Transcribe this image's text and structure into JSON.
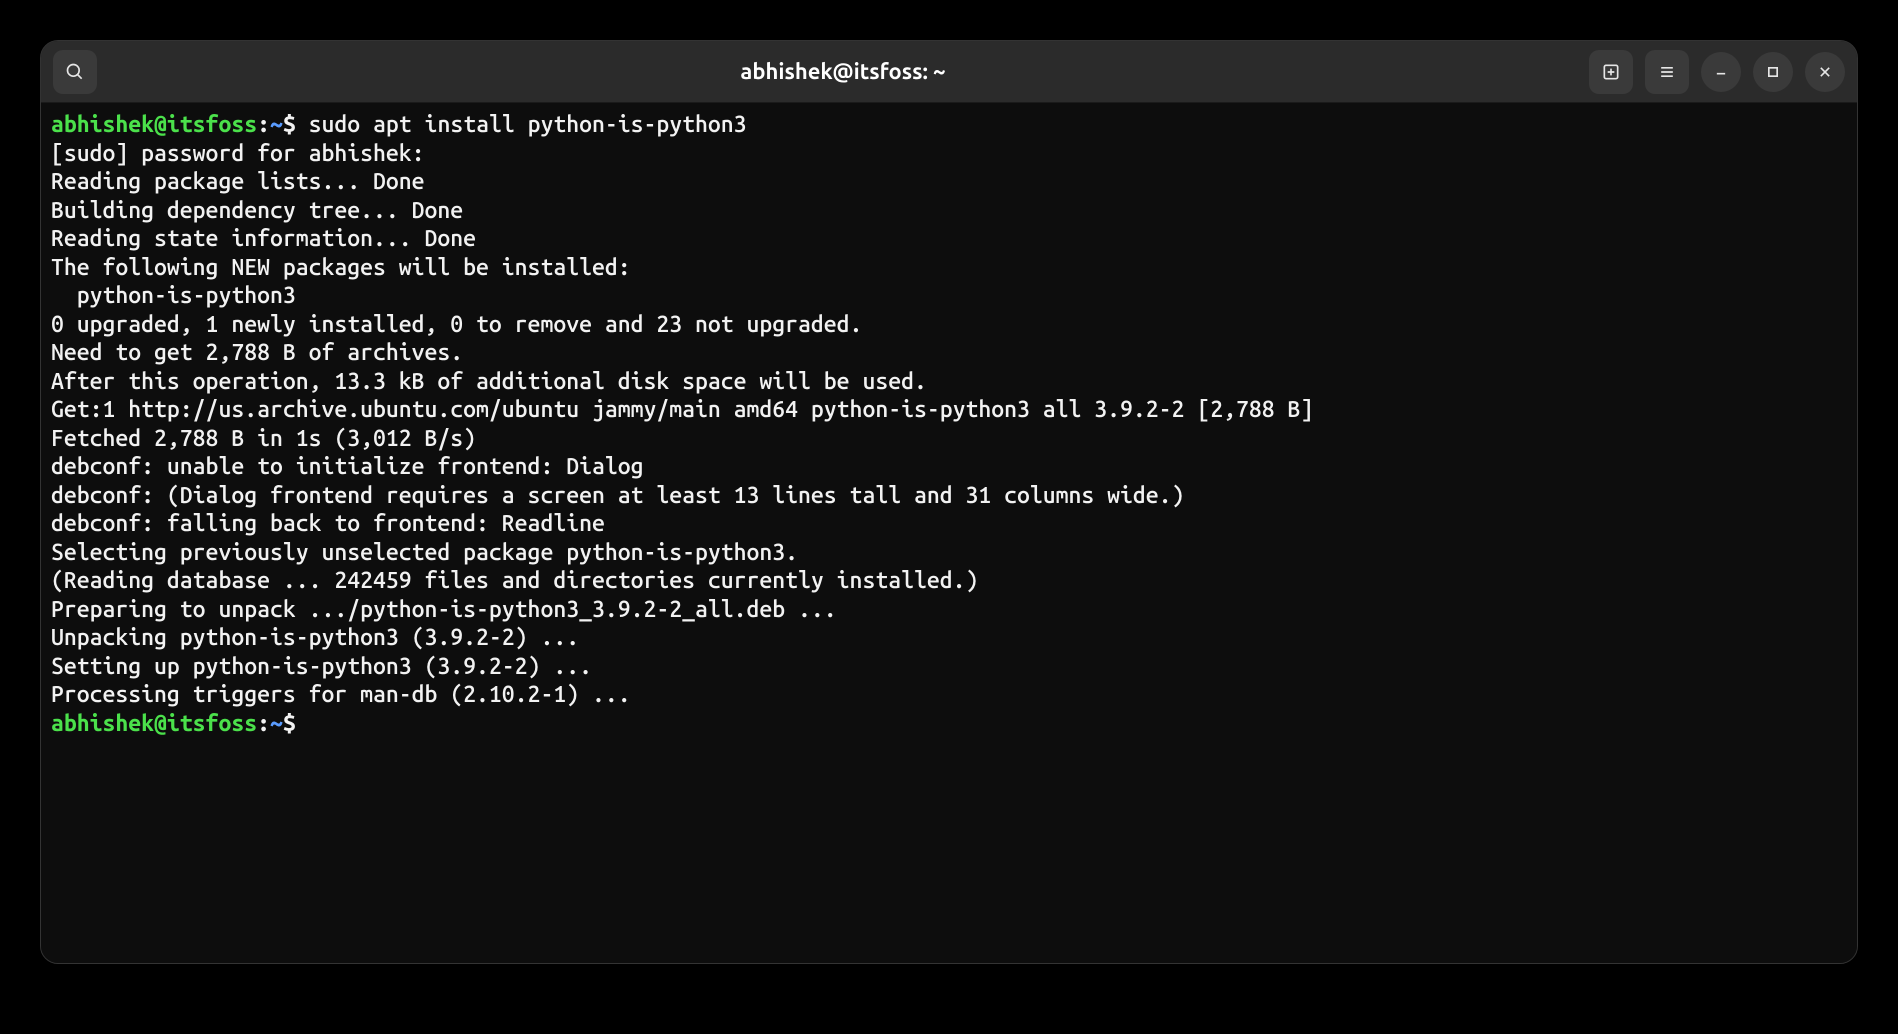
{
  "titlebar": {
    "title": "abhishek@itsfoss: ~"
  },
  "prompt": {
    "user_host": "abhishek@itsfoss",
    "sep1": ":",
    "path": "~",
    "sep2": "$ "
  },
  "command": "sudo apt install python-is-python3",
  "output_lines": [
    "[sudo] password for abhishek: ",
    "Reading package lists... Done",
    "Building dependency tree... Done",
    "Reading state information... Done",
    "The following NEW packages will be installed:",
    "  python-is-python3",
    "0 upgraded, 1 newly installed, 0 to remove and 23 not upgraded.",
    "Need to get 2,788 B of archives.",
    "After this operation, 13.3 kB of additional disk space will be used.",
    "Get:1 http://us.archive.ubuntu.com/ubuntu jammy/main amd64 python-is-python3 all 3.9.2-2 [2,788 B]",
    "Fetched 2,788 B in 1s (3,012 B/s)",
    "debconf: unable to initialize frontend: Dialog",
    "debconf: (Dialog frontend requires a screen at least 13 lines tall and 31 columns wide.)",
    "debconf: falling back to frontend: Readline",
    "Selecting previously unselected package python-is-python3.",
    "(Reading database ... 242459 files and directories currently installed.)",
    "Preparing to unpack .../python-is-python3_3.9.2-2_all.deb ...",
    "Unpacking python-is-python3 (3.9.2-2) ...",
    "Setting up python-is-python3 (3.9.2-2) ...",
    "Processing triggers for man-db (2.10.2-1) ..."
  ]
}
